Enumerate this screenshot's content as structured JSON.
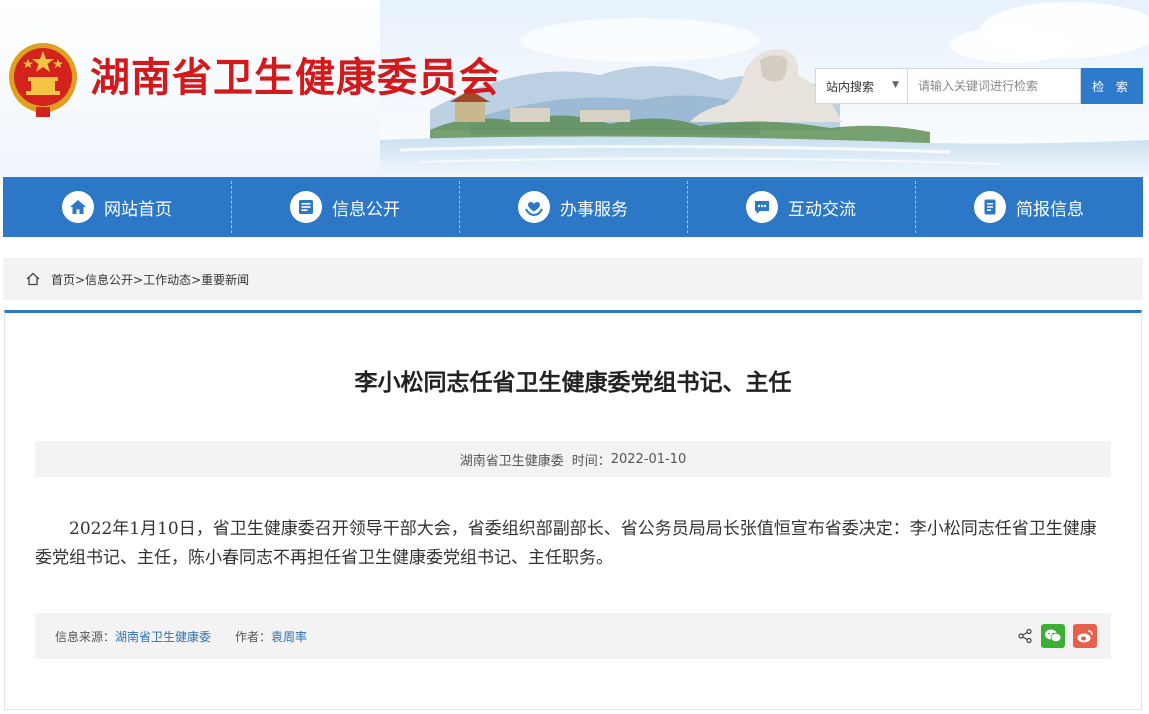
{
  "header": {
    "site_title": "湖南省卫生健康委员会",
    "search": {
      "scope_label": "站内搜索",
      "placeholder": "请输入关键词进行检索",
      "button_label": "检 索"
    }
  },
  "nav": {
    "items": [
      {
        "label": "网站首页",
        "icon": "home-icon"
      },
      {
        "label": "信息公开",
        "icon": "document-list-icon"
      },
      {
        "label": "办事服务",
        "icon": "heart-hands-icon"
      },
      {
        "label": "互动交流",
        "icon": "chat-icon"
      },
      {
        "label": "简报信息",
        "icon": "report-icon"
      }
    ]
  },
  "breadcrumb": {
    "text": "首页>信息公开>工作动态>重要新闻"
  },
  "article": {
    "title": "李小松同志任省卫生健康委党组书记、主任",
    "source": "湖南省卫生健康委",
    "time_label": "时间：",
    "time": "2022-01-10",
    "body": "2022年1月10日，省卫生健康委召开领导干部大会，省委组织部副部长、省公务员局局长张值恒宣布省委决定：李小松同志任省卫生健康委党组书记、主任，陈小春同志不再担任省卫生健康委党组书记、主任职务。",
    "footer": {
      "source_label": "信息来源：",
      "source_value": "湖南省卫生健康委",
      "author_label": "作者：",
      "author_value": "袁周率"
    }
  },
  "colors": {
    "brand_red": "#d2191c",
    "nav_blue": "#2c78c7",
    "wechat_green": "#3cb034",
    "weibo_red": "#e8604c"
  }
}
